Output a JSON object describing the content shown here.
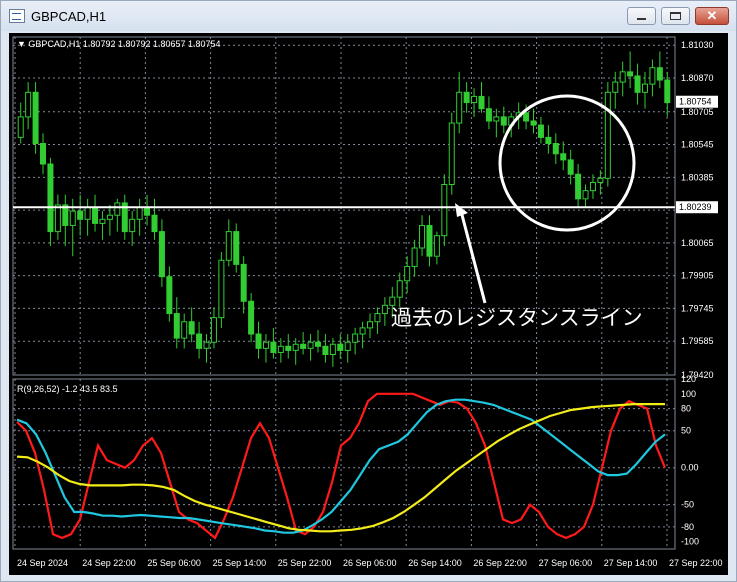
{
  "window": {
    "title": "GBPCAD,H1",
    "icons": {
      "app": "chart-window-icon",
      "min": "minimize-icon",
      "max": "maximize-icon",
      "close": "close-icon"
    },
    "close_glyph": "✕"
  },
  "chart_data": [
    {
      "type": "candlestick",
      "symbol_info": "▼ GBPCAD,H1  1.80792 1.80792 1.80657 1.80754",
      "y_ticks": [
        "1.81030",
        "1.80870",
        "1.80705",
        "1.80545",
        "1.80385",
        "1.80225",
        "1.80065",
        "1.79905",
        "1.79745",
        "1.79585",
        "1.79420"
      ],
      "ylim": [
        1.7942,
        1.8107
      ],
      "current_price": "1.80754",
      "resistance_price": "1.80239",
      "annotation": "過去のレジスタンスライン",
      "candles": [
        [
          1.8058,
          1.8075,
          1.8055,
          1.8068
        ],
        [
          1.8068,
          1.8085,
          1.8062,
          1.808
        ],
        [
          1.808,
          1.8085,
          1.805,
          1.8055
        ],
        [
          1.8055,
          1.806,
          1.804,
          1.8045
        ],
        [
          1.8045,
          1.8048,
          1.8005,
          1.8012
        ],
        [
          1.8012,
          1.803,
          1.8008,
          1.8025
        ],
        [
          1.8025,
          1.803,
          1.8005,
          1.8015
        ],
        [
          1.8015,
          1.8028,
          1.8,
          1.8022
        ],
        [
          1.8022,
          1.803,
          1.801,
          1.8018
        ],
        [
          1.8018,
          1.8028,
          1.801,
          1.8024
        ],
        [
          1.8024,
          1.803,
          1.8012,
          1.8016
        ],
        [
          1.8016,
          1.8022,
          1.8008,
          1.8018
        ],
        [
          1.8018,
          1.8025,
          1.801,
          1.802
        ],
        [
          1.802,
          1.8028,
          1.8012,
          1.8026
        ],
        [
          1.8026,
          1.803,
          1.8008,
          1.8012
        ],
        [
          1.8012,
          1.8022,
          1.8005,
          1.8018
        ],
        [
          1.8018,
          1.8028,
          1.801,
          1.8024
        ],
        [
          1.8024,
          1.803,
          1.8015,
          1.802
        ],
        [
          1.802,
          1.8028,
          1.8008,
          1.8012
        ],
        [
          1.8012,
          1.8018,
          1.7985,
          1.799
        ],
        [
          1.799,
          1.7995,
          1.7968,
          1.7972
        ],
        [
          1.7972,
          1.798,
          1.7955,
          1.796
        ],
        [
          1.796,
          1.7972,
          1.7955,
          1.7968
        ],
        [
          1.7968,
          1.7975,
          1.7958,
          1.7962
        ],
        [
          1.7962,
          1.7968,
          1.795,
          1.7955
        ],
        [
          1.7955,
          1.7962,
          1.7948,
          1.7958
        ],
        [
          1.7958,
          1.7975,
          1.7955,
          1.797
        ],
        [
          1.797,
          1.8002,
          1.7965,
          1.7998
        ],
        [
          1.7998,
          1.8018,
          1.7995,
          1.8012
        ],
        [
          1.8012,
          1.8016,
          1.7992,
          1.7996
        ],
        [
          1.7996,
          1.8,
          1.7972,
          1.7978
        ],
        [
          1.7978,
          1.7982,
          1.7958,
          1.7962
        ],
        [
          1.7962,
          1.7968,
          1.795,
          1.7955
        ],
        [
          1.7955,
          1.7962,
          1.7948,
          1.7958
        ],
        [
          1.7958,
          1.7965,
          1.795,
          1.7953
        ],
        [
          1.7953,
          1.796,
          1.7948,
          1.7956
        ],
        [
          1.7956,
          1.7962,
          1.795,
          1.7954
        ],
        [
          1.7954,
          1.796,
          1.7947,
          1.7957
        ],
        [
          1.7957,
          1.7963,
          1.7952,
          1.7955
        ],
        [
          1.7955,
          1.7962,
          1.7949,
          1.7958
        ],
        [
          1.7958,
          1.7964,
          1.7953,
          1.7956
        ],
        [
          1.7956,
          1.7962,
          1.7948,
          1.7952
        ],
        [
          1.7952,
          1.796,
          1.7946,
          1.7957
        ],
        [
          1.7957,
          1.7962,
          1.795,
          1.7954
        ],
        [
          1.7954,
          1.7962,
          1.7948,
          1.7958
        ],
        [
          1.7958,
          1.7965,
          1.7952,
          1.7962
        ],
        [
          1.7962,
          1.7968,
          1.7955,
          1.7965
        ],
        [
          1.7965,
          1.7972,
          1.796,
          1.7968
        ],
        [
          1.7968,
          1.7975,
          1.7962,
          1.7972
        ],
        [
          1.7972,
          1.798,
          1.7966,
          1.7976
        ],
        [
          1.7976,
          1.7985,
          1.797,
          1.798
        ],
        [
          1.798,
          1.7992,
          1.7975,
          1.7988
        ],
        [
          1.7988,
          1.8,
          1.7982,
          1.7995
        ],
        [
          1.7995,
          1.8008,
          1.799,
          1.8004
        ],
        [
          1.8004,
          1.802,
          1.8,
          1.8015
        ],
        [
          1.8015,
          1.802,
          1.7995,
          1.8
        ],
        [
          1.8,
          1.8012,
          1.7996,
          1.801
        ],
        [
          1.801,
          1.804,
          1.8005,
          1.8035
        ],
        [
          1.8035,
          1.807,
          1.803,
          1.8065
        ],
        [
          1.8065,
          1.809,
          1.806,
          1.808
        ],
        [
          1.808,
          1.8085,
          1.807,
          1.8075
        ],
        [
          1.8075,
          1.8082,
          1.8068,
          1.8078
        ],
        [
          1.8078,
          1.8085,
          1.807,
          1.8072
        ],
        [
          1.8072,
          1.8078,
          1.8062,
          1.8066
        ],
        [
          1.8066,
          1.8072,
          1.8058,
          1.8068
        ],
        [
          1.8068,
          1.8073,
          1.806,
          1.8064
        ],
        [
          1.8064,
          1.807,
          1.8058,
          1.8068
        ],
        [
          1.8068,
          1.8075,
          1.8062,
          1.807
        ],
        [
          1.807,
          1.8074,
          1.8062,
          1.8066
        ],
        [
          1.8066,
          1.8072,
          1.806,
          1.8064
        ],
        [
          1.8064,
          1.8068,
          1.8055,
          1.8058
        ],
        [
          1.8058,
          1.8064,
          1.805,
          1.8055
        ],
        [
          1.8055,
          1.806,
          1.8045,
          1.805
        ],
        [
          1.805,
          1.8056,
          1.8042,
          1.8047
        ],
        [
          1.8047,
          1.8052,
          1.8035,
          1.804
        ],
        [
          1.804,
          1.8045,
          1.8024,
          1.8028
        ],
        [
          1.8028,
          1.8035,
          1.8024,
          1.8032
        ],
        [
          1.8032,
          1.804,
          1.8028,
          1.8036
        ],
        [
          1.8036,
          1.8042,
          1.803,
          1.8038
        ],
        [
          1.8038,
          1.8085,
          1.8034,
          1.808
        ],
        [
          1.808,
          1.809,
          1.8072,
          1.8085
        ],
        [
          1.8085,
          1.8095,
          1.8078,
          1.809
        ],
        [
          1.809,
          1.81,
          1.8082,
          1.8088
        ],
        [
          1.8088,
          1.8094,
          1.8074,
          1.808
        ],
        [
          1.808,
          1.809,
          1.8072,
          1.8084
        ],
        [
          1.8084,
          1.8096,
          1.8078,
          1.8092
        ],
        [
          1.8092,
          1.81,
          1.8082,
          1.8086
        ],
        [
          1.8086,
          1.809,
          1.8068,
          1.8075
        ]
      ]
    },
    {
      "type": "line",
      "indicator_label": "R(9,26,52) -1.2 43.5 83.5",
      "y_ticks": [
        "120",
        "100",
        "80",
        "50",
        "0.00",
        "-50",
        "-80",
        "-100"
      ],
      "ylim": [
        -110,
        120
      ],
      "series": [
        {
          "color": "#ff1a1a",
          "values": [
            62,
            50,
            20,
            -30,
            -90,
            -95,
            -90,
            -70,
            -20,
            30,
            10,
            5,
            0,
            10,
            30,
            40,
            20,
            -20,
            -60,
            -70,
            -75,
            -85,
            -95,
            -70,
            -40,
            0,
            40,
            60,
            40,
            0,
            -40,
            -85,
            -90,
            -80,
            -60,
            -20,
            30,
            40,
            60,
            90,
            100,
            100,
            100,
            100,
            100,
            95,
            90,
            85,
            90,
            88,
            80,
            60,
            30,
            -20,
            -70,
            -75,
            -70,
            -50,
            -60,
            -80,
            -90,
            -95,
            -90,
            -80,
            -50,
            0,
            50,
            80,
            90,
            85,
            80,
            30,
            0
          ]
        },
        {
          "color": "#1fc8e0",
          "values": [
            65,
            60,
            45,
            20,
            -10,
            -40,
            -60,
            -60,
            -62,
            -65,
            -65,
            -66,
            -65,
            -64,
            -65,
            -66,
            -67,
            -68,
            -68,
            -70,
            -72,
            -74,
            -76,
            -78,
            -80,
            -82,
            -85,
            -86,
            -88,
            -88,
            -85,
            -78,
            -70,
            -60,
            -45,
            -30,
            -10,
            10,
            25,
            30,
            35,
            45,
            60,
            75,
            85,
            90,
            92,
            92,
            90,
            88,
            85,
            80,
            75,
            70,
            65,
            55,
            45,
            35,
            25,
            15,
            5,
            -5,
            -10,
            -10,
            -8,
            5,
            20,
            35,
            45
          ]
        },
        {
          "color": "#f2ec18",
          "values": [
            15,
            14,
            8,
            0,
            -10,
            -18,
            -22,
            -24,
            -24,
            -24,
            -24,
            -23,
            -23,
            -24,
            -26,
            -30,
            -38,
            -45,
            -50,
            -54,
            -58,
            -62,
            -66,
            -70,
            -74,
            -78,
            -82,
            -84,
            -85,
            -86,
            -86,
            -85,
            -84,
            -82,
            -79,
            -74,
            -68,
            -60,
            -50,
            -40,
            -28,
            -16,
            -4,
            6,
            16,
            26,
            36,
            44,
            52,
            58,
            64,
            70,
            74,
            78,
            80,
            82,
            83,
            84,
            85,
            86,
            86,
            86,
            86
          ]
        }
      ]
    }
  ],
  "x_ticks": [
    "24 Sep 2024",
    "24 Sep 22:00",
    "25 Sep 06:00",
    "25 Sep 14:00",
    "25 Sep 22:00",
    "26 Sep 06:00",
    "26 Sep 14:00",
    "26 Sep 22:00",
    "27 Sep 06:00",
    "27 Sep 14:00",
    "27 Sep 22:00"
  ],
  "colors": {
    "bg": "#000000",
    "grid": "#7f8a99",
    "fg": "#ffffff",
    "candle": "#32cd32",
    "resistance": "#ffffff"
  }
}
